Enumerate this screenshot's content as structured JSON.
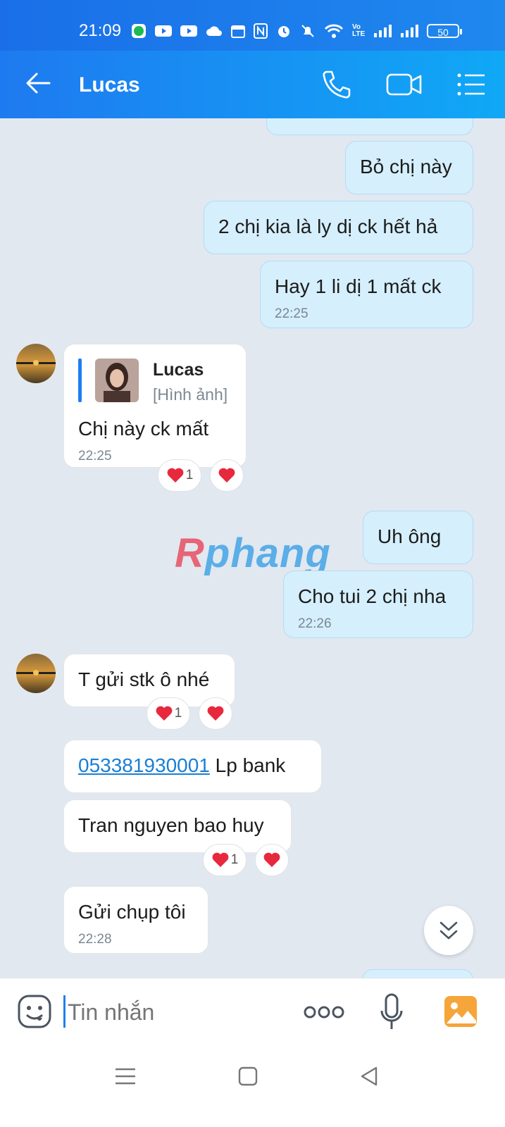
{
  "status_bar": {
    "time": "21:09",
    "battery": "50",
    "icons": [
      "spotify-icon",
      "youtube-icon",
      "youtube-icon",
      "cloud-icon",
      "calendar-icon",
      "nfc-icon",
      "alarm-icon",
      "mute-icon",
      "wifi-icon",
      "volte-icon",
      "signal-icon",
      "signal-icon"
    ]
  },
  "header": {
    "contact_name": "Lucas"
  },
  "messages": [
    {
      "side": "out",
      "text": "Bỏ chị này"
    },
    {
      "side": "out",
      "text": "2 chị kia là ly dị ck hết hả"
    },
    {
      "side": "out",
      "text": "Hay 1 li dị 1 mất ck",
      "time": "22:25"
    },
    {
      "side": "in",
      "quote_name": "Lucas",
      "quote_text": "[Hình ảnh]",
      "text": "Chị này ck mất",
      "time": "22:25",
      "reaction_count": "1"
    },
    {
      "side": "out",
      "text": "Uh ông"
    },
    {
      "side": "out",
      "text": "Cho tui 2 chị nha",
      "time": "22:26"
    },
    {
      "side": "in",
      "text": "T gửi stk ô nhé",
      "reaction_count": "1"
    },
    {
      "side": "in",
      "link": "053381930001",
      "text": " Lp bank"
    },
    {
      "side": "in",
      "text": "Tran nguyen bao huy",
      "reaction_count": "1"
    },
    {
      "side": "in",
      "text": "Gửi chụp tôi",
      "time": "22:28"
    }
  ],
  "watermark": {
    "first": "R",
    "rest": "phang"
  },
  "composer": {
    "placeholder": "Tin nhắn"
  },
  "colors": {
    "header_gradient_start": "#1e7af0",
    "header_gradient_end": "#10a8f6",
    "outgoing_bubble": "#d5effd",
    "incoming_bubble": "#ffffff",
    "chat_background": "#e2e8f0",
    "link": "#1a7fd4",
    "heart": "#e8283c"
  }
}
